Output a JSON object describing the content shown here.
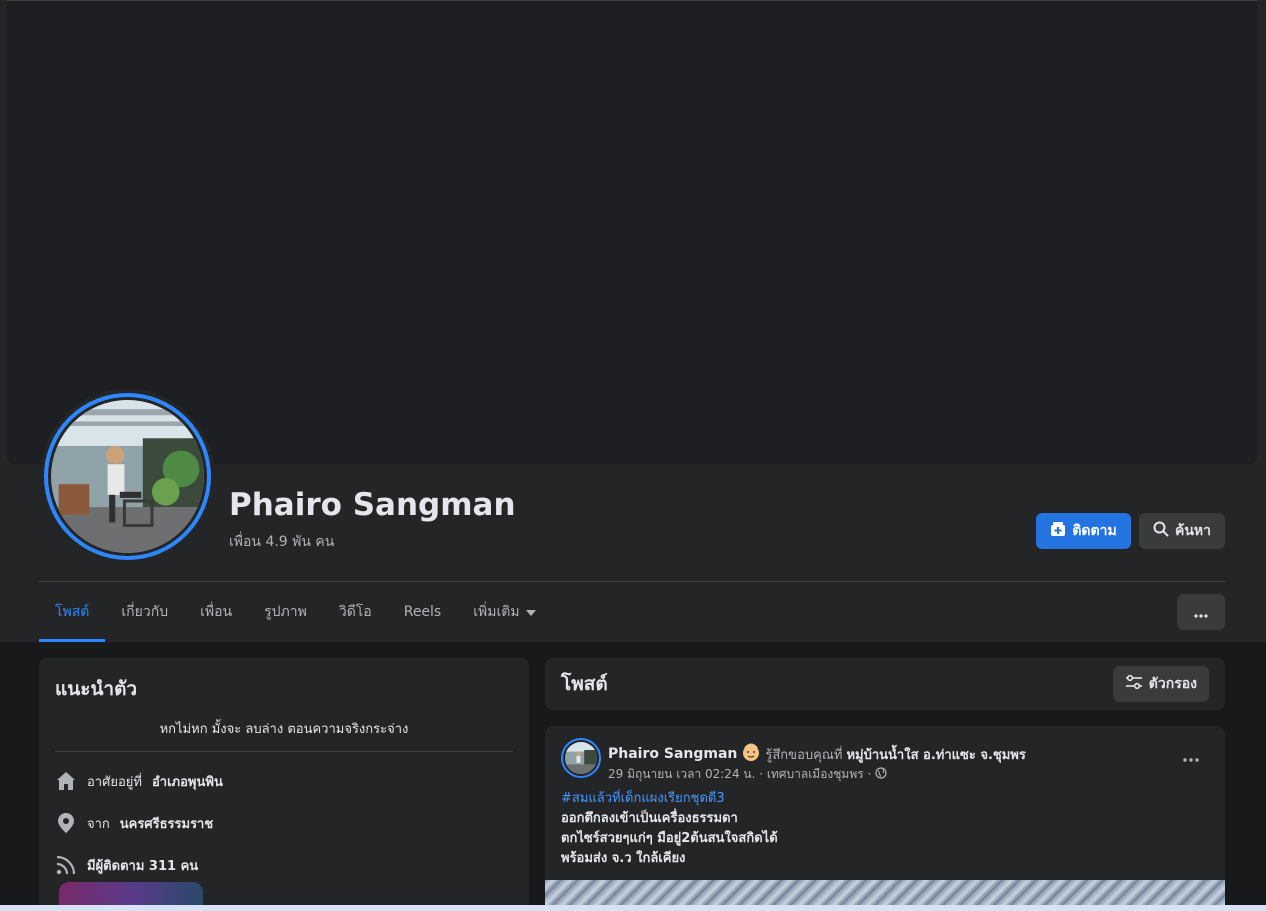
{
  "profile": {
    "name": "Phairo Sangman",
    "friends": "เพื่อน 4.9 พัน คน"
  },
  "actions": {
    "follow_label": "ติดตาม",
    "search_label": "ค้นหา"
  },
  "tabs": [
    {
      "label": "โพสต์",
      "active": true
    },
    {
      "label": "เกี่ยวกับ"
    },
    {
      "label": "เพื่อน"
    },
    {
      "label": "รูปภาพ"
    },
    {
      "label": "วิดีโอ"
    },
    {
      "label": "Reels"
    },
    {
      "label": "เพิ่มเติม"
    }
  ],
  "intro": {
    "title": "แนะนำตัว",
    "bio": "หกไม่หก มั้งจะ ลบล่าง ตอนความจริงกระจ่าง",
    "lives_prefix": "อาศัยอยู่ที่",
    "lives_value": "อำเภอพุนพิน",
    "from_prefix": "จาก",
    "from_value": "นครศรีธรรมราช",
    "followers": "มีผู้ติดตาม 311 คน"
  },
  "posts_section": {
    "title": "โพสต์",
    "filter_label": "ตัวกรอง"
  },
  "post": {
    "author": "Phairo Sangman",
    "feeling": "รู้สึกขอบคุณที่",
    "place": "หมู่บ้านน้ำใส อ.ท่าแซะ จ.ชุมพร",
    "meta": "29 มิถุนายน เวลา 02:24 น. · เทศบาลเมืองชุมพร ·",
    "hashtag": "#สมแล้วที่เด็กแผงเรียกชุดดี3",
    "lines": [
      "ออกตึกลงเข้าเป็นเครื่องธรรมดา",
      "ตกไซร์สวยๆแก่ๆ มือยู่2ต้นสนใจสกิดได้",
      "พร้อมส่ง จ.ว ใกล้เคียง"
    ]
  },
  "colors": {
    "accent": "#2d88ff",
    "button_primary": "#2374e1",
    "surface": "#242526",
    "background": "#18191a"
  }
}
